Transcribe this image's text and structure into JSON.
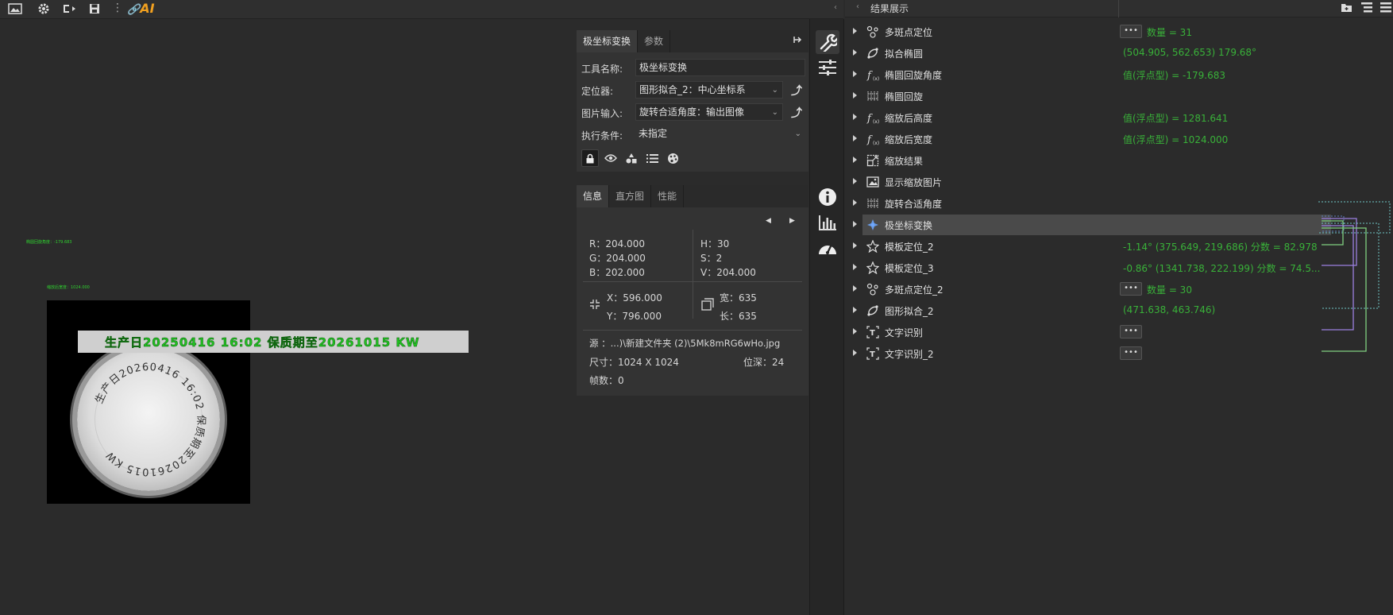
{
  "toolbar": {
    "icons": [
      "image-icon",
      "gear-icon",
      "export-icon",
      "save-icon",
      "more-icon"
    ],
    "ai_label": "AI"
  },
  "canvas": {
    "overlay_text_1": "椭圆回旋角度：-179.683",
    "overlay_text_2": "缩放后宽度：1024.000",
    "strip_text": "生产日20250416 16:02 保质期至20261015 KW",
    "cap_text": "生产日20260416 16:02 保质期至20261015 KW"
  },
  "tool_panel": {
    "tabs": [
      "极坐标变换",
      "参数"
    ],
    "fields": [
      {
        "label": "工具名称:",
        "value": "极坐标变换",
        "has_dropdown": false,
        "has_up": false
      },
      {
        "label": "定位器:",
        "value": "图形拟合_2：中心坐标系",
        "has_dropdown": true,
        "has_up": true
      },
      {
        "label": "图片输入:",
        "value": "旋转合适角度：输出图像",
        "has_dropdown": true,
        "has_up": true
      },
      {
        "label": "执行条件:",
        "value": "未指定",
        "has_dropdown": true,
        "has_up": false
      }
    ],
    "icon_buttons": [
      "lock-icon",
      "eye-icon",
      "shapes-icon",
      "list-icon",
      "palette-icon"
    ]
  },
  "info_panel": {
    "tabs": [
      "信息",
      "直方图",
      "性能"
    ],
    "rgb": {
      "r": "R：204.000",
      "g": "G：204.000",
      "b": "B：202.000"
    },
    "hsv": {
      "h": "H：30",
      "s": "S：2",
      "v": "V：204.000"
    },
    "pos": {
      "x": "X：596.000",
      "y": "Y：796.000"
    },
    "size": {
      "w": "宽：635",
      "h": "长：635"
    },
    "source": "源  ：...)\\新建文件夹 (2)\\5Mk8mRG6wHo.jpg",
    "dimension": "尺寸：1024 X 1024",
    "depth": "位深：24",
    "frames": "帧数：0"
  },
  "results": {
    "title": "结果展示",
    "rows": [
      {
        "name": "多斑点定位",
        "icon": "multi-blob-icon",
        "button": true,
        "value": "数量 = 31"
      },
      {
        "name": "拟合椭圆",
        "icon": "fit-ellipse-icon",
        "button": false,
        "value": "(504.905, 562.653) 179.68°"
      },
      {
        "name": "椭圆回旋角度",
        "icon": "function-icon",
        "button": false,
        "value": "值(浮点型) = -179.683"
      },
      {
        "name": "椭圆回旋",
        "icon": "rotate-grid-icon",
        "button": false,
        "value": ""
      },
      {
        "name": "缩放后高度",
        "icon": "function-icon",
        "button": false,
        "value": "值(浮点型) = 1281.641"
      },
      {
        "name": "缩放后宽度",
        "icon": "function-icon",
        "button": false,
        "value": "值(浮点型) = 1024.000"
      },
      {
        "name": "缩放结果",
        "icon": "scale-icon",
        "button": false,
        "value": ""
      },
      {
        "name": "显示缩放图片",
        "icon": "picture-icon",
        "button": false,
        "value": ""
      },
      {
        "name": "旋转合适角度",
        "icon": "rotate-grid-icon",
        "button": false,
        "value": ""
      },
      {
        "name": "极坐标变换",
        "icon": "polar-icon",
        "button": false,
        "value": "",
        "active": true
      },
      {
        "name": "模板定位_2",
        "icon": "star-icon",
        "button": false,
        "value": "-1.14° (375.649, 219.686) 分数 = 82.978"
      },
      {
        "name": "模板定位_3",
        "icon": "star-icon",
        "button": false,
        "value": "-0.86° (1341.738, 222.199) 分数 = 74.5..."
      },
      {
        "name": "多斑点定位_2",
        "icon": "multi-blob-icon",
        "button": true,
        "value": "数量 = 30"
      },
      {
        "name": "图形拟合_2",
        "icon": "fit-ellipse-icon",
        "button": false,
        "value": "(471.638, 463.746)"
      },
      {
        "name": "文字识别",
        "icon": "ocr-icon",
        "button": true,
        "value": ""
      },
      {
        "name": "文字识别_2",
        "icon": "ocr-icon",
        "button": true,
        "value": ""
      }
    ]
  },
  "colors": {
    "accent_green": "#39b139",
    "link_purple": "#9b7fe0",
    "link_green": "#7fd07f",
    "link_cyan": "#6fc6c6"
  }
}
